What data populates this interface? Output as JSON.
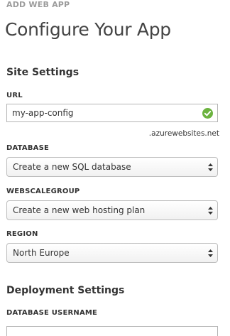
{
  "header": {
    "label": "ADD WEB APP",
    "title": "Configure Your App"
  },
  "site_settings": {
    "heading": "Site Settings",
    "url": {
      "label": "URL",
      "value": "my-app-config",
      "suffix": ".azurewebsites.net",
      "status_icon": "check-circle-icon",
      "status_color": "#6cb33f"
    },
    "database": {
      "label": "DATABASE",
      "selected": "Create a new SQL database"
    },
    "webscalegroup": {
      "label": "WEBSCALEGROUP",
      "selected": "Create a new web hosting plan"
    },
    "region": {
      "label": "REGION",
      "selected": "North Europe"
    }
  },
  "deployment_settings": {
    "heading": "Deployment Settings",
    "database_username": {
      "label": "DATABASE USERNAME",
      "value": ""
    }
  }
}
